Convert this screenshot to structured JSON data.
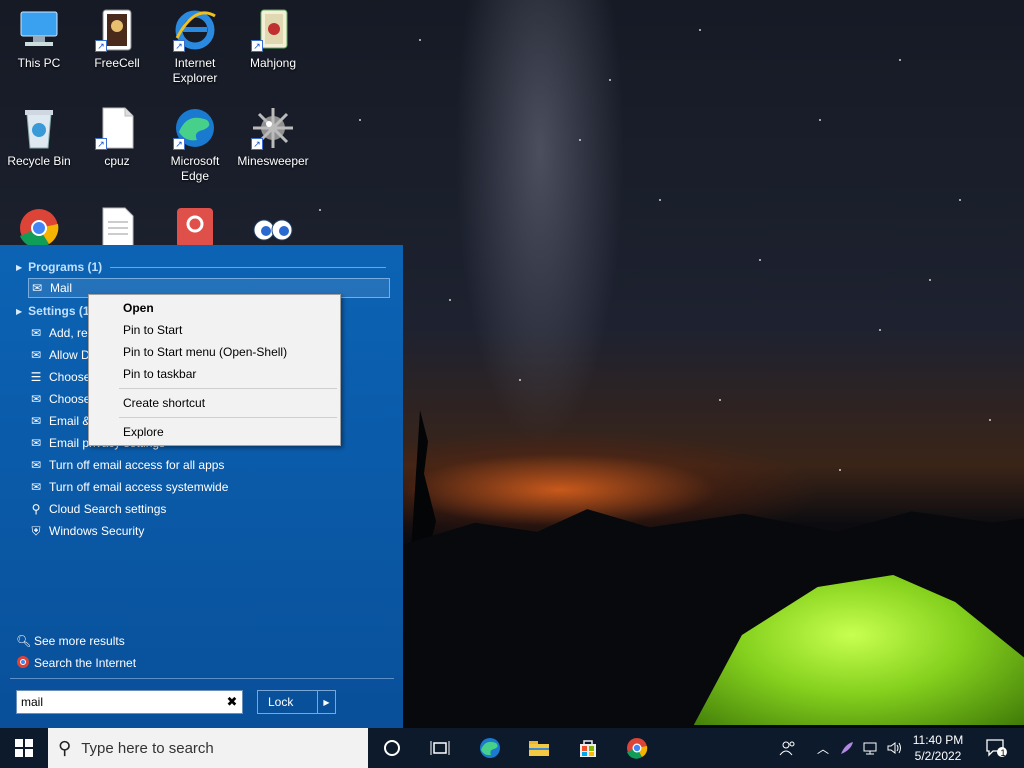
{
  "desktop": {
    "icons": [
      {
        "label": "This PC"
      },
      {
        "label": "FreeCell"
      },
      {
        "label": "Internet Explorer"
      },
      {
        "label": "Mahjong"
      },
      {
        "label": "Recycle Bin"
      },
      {
        "label": "cpuz"
      },
      {
        "label": "Microsoft Edge"
      },
      {
        "label": "Minesweeper"
      }
    ]
  },
  "start_menu": {
    "programs_header": "Programs (1)",
    "settings_header": "Settings (1",
    "program_items": [
      {
        "label": "Mail"
      }
    ],
    "setting_items": [
      {
        "label": "Add, re"
      },
      {
        "label": "Allow D"
      },
      {
        "label": "Choose"
      },
      {
        "label": "Choose"
      },
      {
        "label": "Email &"
      },
      {
        "label": "Email privacy settings"
      },
      {
        "label": "Turn off email access for all apps"
      },
      {
        "label": "Turn off email access systemwide"
      },
      {
        "label": "Cloud Search settings"
      },
      {
        "label": "Windows Security"
      }
    ],
    "see_more": "See more results",
    "search_internet": "Search the Internet",
    "search_value": "mail",
    "clear_glyph": "✖",
    "lock_label": "Lock"
  },
  "context_menu": {
    "items": [
      {
        "label": "Open"
      },
      {
        "label": "Pin to Start"
      },
      {
        "label": "Pin to Start menu (Open-Shell)"
      },
      {
        "label": "Pin to taskbar"
      },
      {
        "label": "Create shortcut"
      },
      {
        "label": "Explore"
      }
    ]
  },
  "taskbar": {
    "search_placeholder": "Type here to search",
    "time": "11:40 PM",
    "date": "5/2/2022",
    "notification_count": "1"
  },
  "colors": {
    "start_menu_bg": "#0a5aa8",
    "taskbar_bg": "#0d1a2b",
    "tent_green": "#86d21e"
  }
}
